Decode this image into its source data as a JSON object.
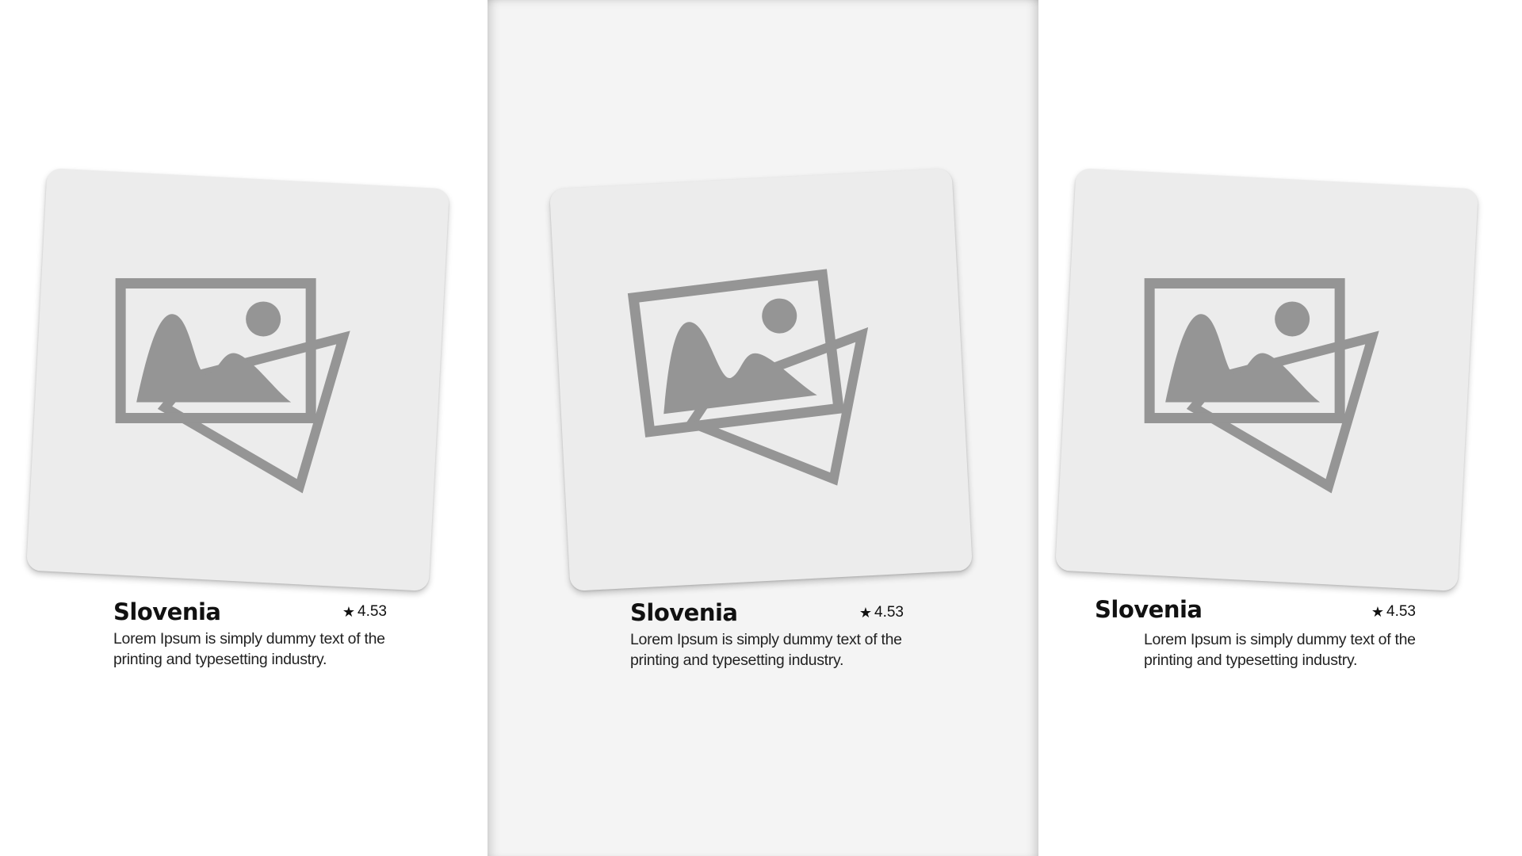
{
  "cards": [
    {
      "title": "Slovenia",
      "rating": "4.53",
      "star_icon": "star-icon",
      "description": "Lorem Ipsum is simply dummy text of the printing and typesetting industry.",
      "image_icon": "image-placeholder-icon"
    },
    {
      "title": "Slovenia",
      "rating": "4.53",
      "star_icon": "star-icon",
      "description": "Lorem Ipsum is simply dummy text of the printing and typesetting industry.",
      "image_icon": "image-placeholder-icon"
    },
    {
      "title": "Slovenia",
      "rating": "4.53",
      "star_icon": "star-icon",
      "description": "Lorem Ipsum is simply dummy text of the printing and typesetting industry.",
      "image_icon": "image-placeholder-icon"
    }
  ],
  "colors": {
    "page_background": "#ffffff",
    "highlight_panel": "#f4f4f4",
    "tile_background": "#ececec",
    "icon_gray": "#959595",
    "text": "#111111"
  }
}
